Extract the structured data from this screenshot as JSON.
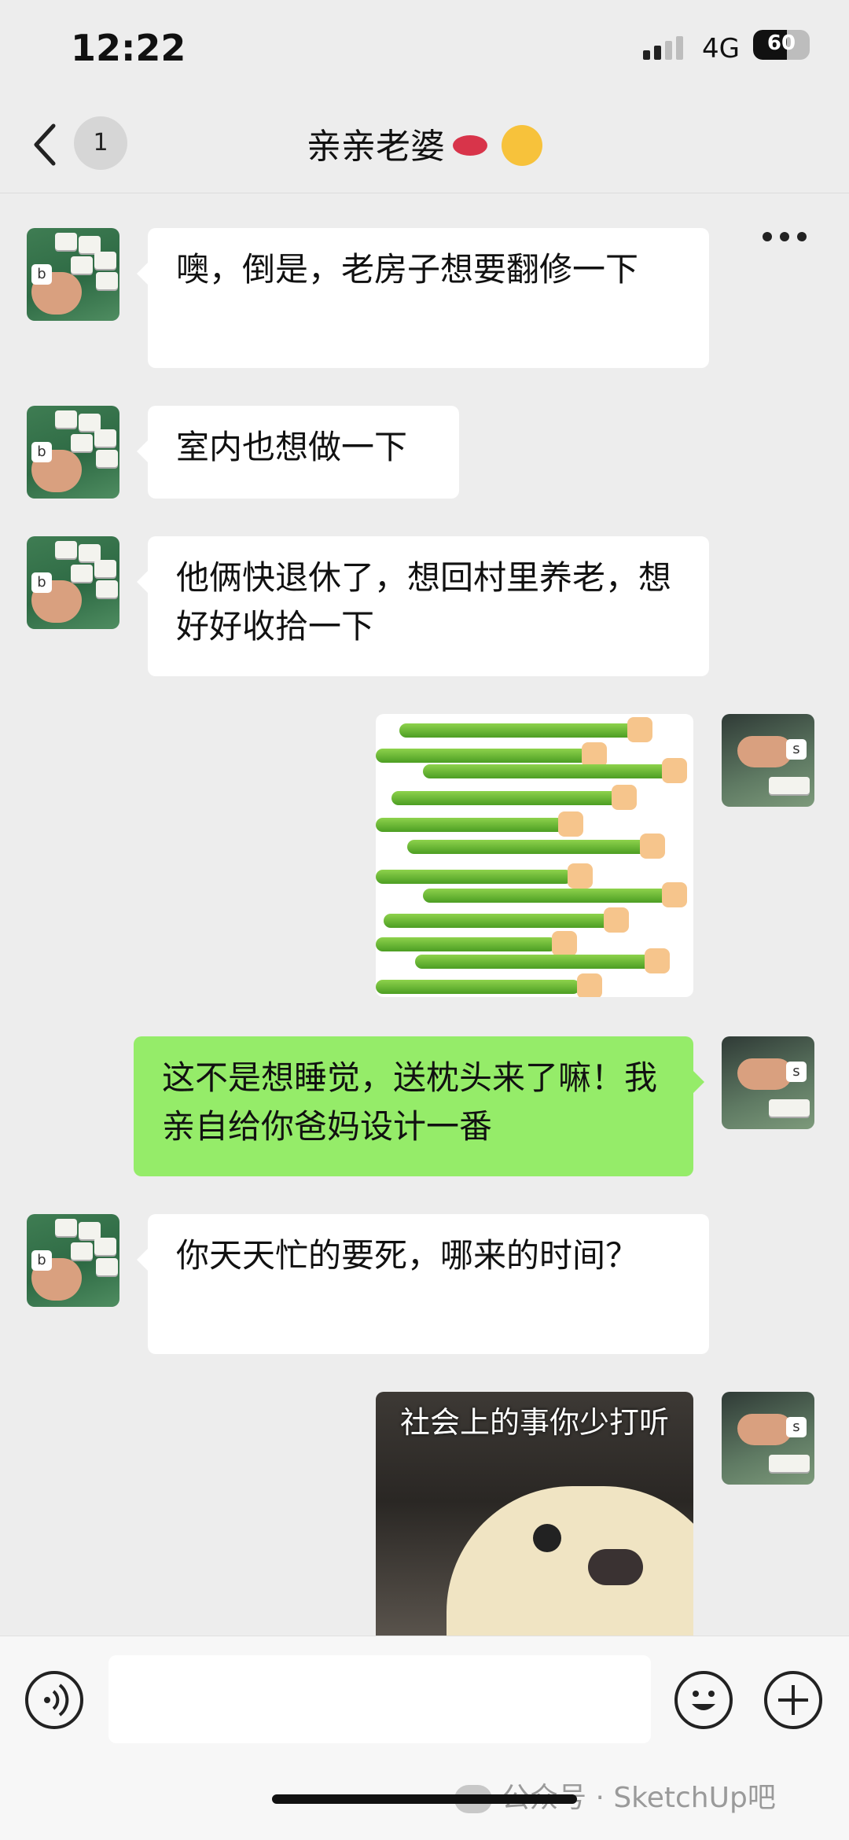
{
  "status_bar": {
    "time": "12:22",
    "network": "4G",
    "battery": "60",
    "battery_level": 0.6
  },
  "header": {
    "unread_count": "1",
    "title": "亲亲老婆",
    "title_emoji_icons": [
      "lips-icon",
      "kissing-face-icon"
    ]
  },
  "messages": [
    {
      "side": "left",
      "type": "text",
      "text": "噢，倒是，老房子想要翻修一下"
    },
    {
      "side": "left",
      "type": "text",
      "text": "室内也想做一下"
    },
    {
      "side": "left",
      "type": "text",
      "text": "他俩快退休了，想回村里养老，想好好收拾一下"
    },
    {
      "side": "right",
      "type": "sticker",
      "sticker": "thumbs-up-scroll-sticker"
    },
    {
      "side": "right",
      "type": "text",
      "text": "这不是想睡觉，送枕头来了嘛！我亲自给你爸妈设计一番"
    },
    {
      "side": "left",
      "type": "text",
      "text": "你天天忙的要死，哪来的时间？"
    },
    {
      "side": "right",
      "type": "sticker",
      "sticker": "surprised-dog-sticker",
      "caption": "社会上的事你少打听"
    }
  ],
  "input_bar": {
    "voice_icon": "voice-icon",
    "emoji_icon": "emoji-icon",
    "plus_icon": "plus-icon",
    "input_value": ""
  },
  "watermark": "公众号 · SketchUp吧",
  "colors": {
    "background": "#ededed",
    "outgoing_bubble": "#95ec69",
    "incoming_bubble": "#ffffff"
  }
}
